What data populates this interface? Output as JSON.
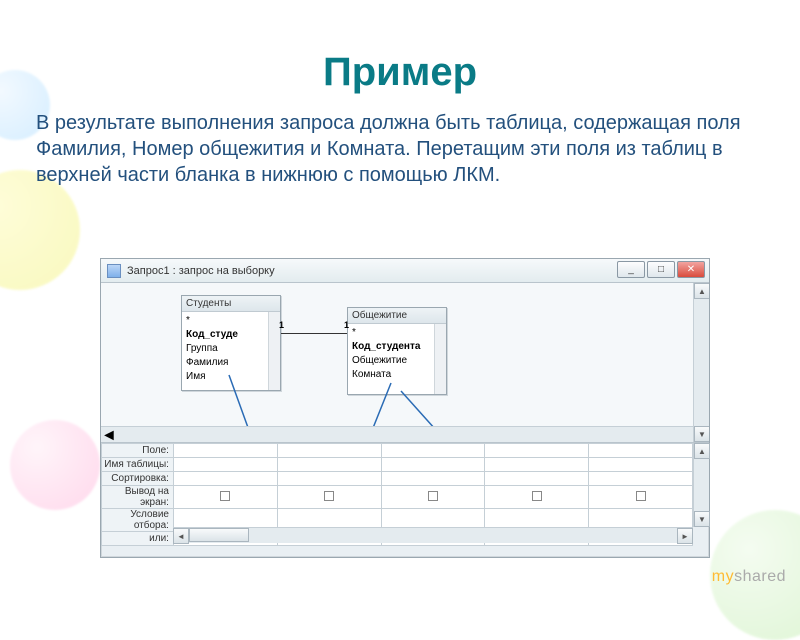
{
  "slide": {
    "title": "Пример",
    "paragraph": "В результате выполнения запроса должна быть таблица, содержащая поля Фамилия, Номер общежития и Комната. Перетащим эти поля из таблиц в верхней части бланка в нижнюю с помощью ЛКМ.",
    "watermark_prefix": "my",
    "watermark_rest": "shared"
  },
  "window": {
    "title": "Запрос1 : запрос на выборку",
    "buttons": {
      "min": "_",
      "max": "□",
      "close": "✕"
    }
  },
  "tables": {
    "t1": {
      "caption": "Студенты",
      "fields": [
        "*",
        "Код_студе",
        "Группа",
        "Фамилия",
        "Имя"
      ],
      "bold_index": 1
    },
    "t2": {
      "caption": "Общежитие",
      "fields": [
        "*",
        "Код_студента",
        "Общежитие",
        "Комната"
      ],
      "bold_index": 1
    }
  },
  "grid": {
    "rows": [
      "Поле:",
      "Имя таблицы:",
      "Сортировка:",
      "Вывод на экран:",
      "Условие отбора:",
      "или:"
    ],
    "checkbox_row_index": 3,
    "columns": 5
  }
}
